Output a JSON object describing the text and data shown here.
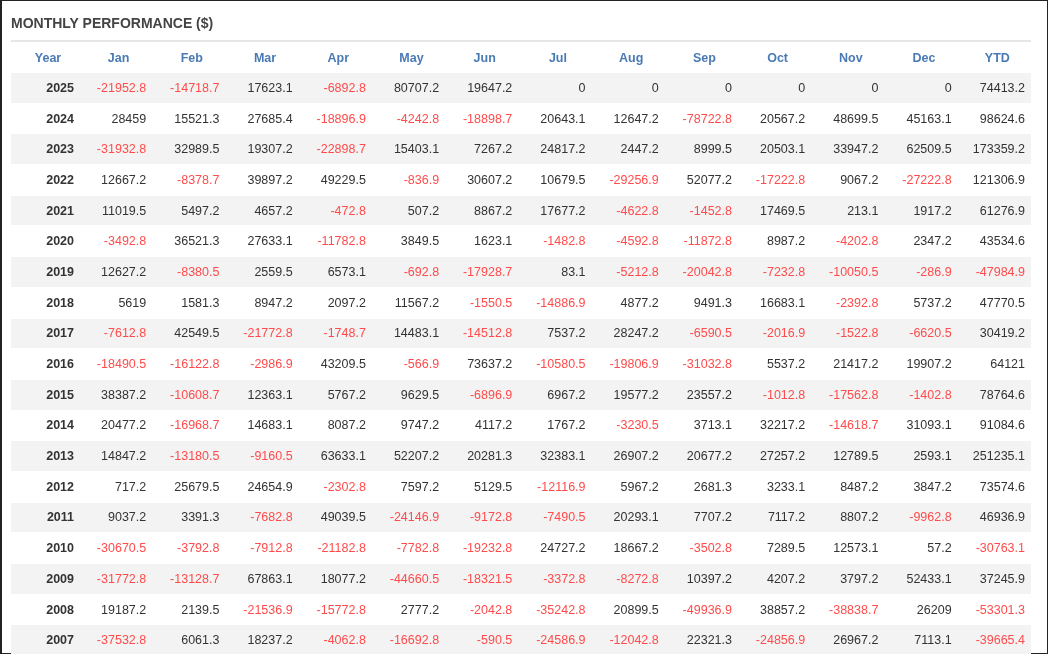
{
  "title": "MONTHLY PERFORMANCE ($)",
  "columns": [
    "Year",
    "Jan",
    "Feb",
    "Mar",
    "Apr",
    "May",
    "Jun",
    "Jul",
    "Aug",
    "Sep",
    "Oct",
    "Nov",
    "Dec",
    "YTD"
  ],
  "rows": [
    {
      "year": "2025",
      "values": [
        "-21952.8",
        "-14718.7",
        "17623.1",
        "-6892.8",
        "80707.2",
        "19647.2",
        "0",
        "0",
        "0",
        "0",
        "0",
        "0",
        "74413.2"
      ],
      "loss": [
        true,
        true,
        false,
        true,
        false,
        false,
        false,
        false,
        false,
        false,
        false,
        false,
        false
      ]
    },
    {
      "year": "2024",
      "values": [
        "28459",
        "15521.3",
        "27685.4",
        "-18896.9",
        "-4242.8",
        "-18898.7",
        "20643.1",
        "12647.2",
        "-78722.8",
        "20567.2",
        "48699.5",
        "45163.1",
        "98624.6"
      ],
      "loss": [
        false,
        false,
        false,
        true,
        true,
        true,
        false,
        false,
        true,
        false,
        false,
        false,
        false
      ]
    },
    {
      "year": "2023",
      "values": [
        "-31932.8",
        "32989.5",
        "19307.2",
        "-22898.7",
        "15403.1",
        "7267.2",
        "24817.2",
        "2447.2",
        "8999.5",
        "20503.1",
        "33947.2",
        "62509.5",
        "173359.2"
      ],
      "loss": [
        true,
        false,
        false,
        true,
        false,
        false,
        false,
        false,
        false,
        false,
        false,
        false,
        false
      ]
    },
    {
      "year": "2022",
      "values": [
        "12667.2",
        "-8378.7",
        "39897.2",
        "49229.5",
        "-836.9",
        "30607.2",
        "10679.5",
        "-29256.9",
        "52077.2",
        "-17222.8",
        "9067.2",
        "-27222.8",
        "121306.9"
      ],
      "loss": [
        false,
        true,
        false,
        false,
        true,
        false,
        false,
        true,
        false,
        true,
        false,
        true,
        false
      ]
    },
    {
      "year": "2021",
      "values": [
        "11019.5",
        "5497.2",
        "4657.2",
        "-472.8",
        "507.2",
        "8867.2",
        "17677.2",
        "-4622.8",
        "-1452.8",
        "17469.5",
        "213.1",
        "1917.2",
        "61276.9"
      ],
      "loss": [
        false,
        false,
        false,
        true,
        false,
        false,
        false,
        true,
        true,
        false,
        false,
        false,
        false
      ]
    },
    {
      "year": "2020",
      "values": [
        "-3492.8",
        "36521.3",
        "27633.1",
        "-11782.8",
        "3849.5",
        "1623.1",
        "-1482.8",
        "-4592.8",
        "-11872.8",
        "8987.2",
        "-4202.8",
        "2347.2",
        "43534.6"
      ],
      "loss": [
        true,
        false,
        false,
        true,
        false,
        false,
        true,
        true,
        true,
        false,
        true,
        false,
        false
      ]
    },
    {
      "year": "2019",
      "values": [
        "12627.2",
        "-8380.5",
        "2559.5",
        "6573.1",
        "-692.8",
        "-17928.7",
        "83.1",
        "-5212.8",
        "-20042.8",
        "-7232.8",
        "-10050.5",
        "-286.9",
        "-47984.9"
      ],
      "loss": [
        false,
        true,
        false,
        false,
        true,
        true,
        false,
        true,
        true,
        true,
        true,
        true,
        true
      ]
    },
    {
      "year": "2018",
      "values": [
        "5619",
        "1581.3",
        "8947.2",
        "2097.2",
        "11567.2",
        "-1550.5",
        "-14886.9",
        "4877.2",
        "9491.3",
        "16683.1",
        "-2392.8",
        "5737.2",
        "47770.5"
      ],
      "loss": [
        false,
        false,
        false,
        false,
        false,
        true,
        true,
        false,
        false,
        false,
        true,
        false,
        false
      ]
    },
    {
      "year": "2017",
      "values": [
        "-7612.8",
        "42549.5",
        "-21772.8",
        "-1748.7",
        "14483.1",
        "-14512.8",
        "7537.2",
        "28247.2",
        "-6590.5",
        "-2016.9",
        "-1522.8",
        "-6620.5",
        "30419.2"
      ],
      "loss": [
        true,
        false,
        true,
        true,
        false,
        true,
        false,
        false,
        true,
        true,
        true,
        true,
        false
      ]
    },
    {
      "year": "2016",
      "values": [
        "-18490.5",
        "-16122.8",
        "-2986.9",
        "43209.5",
        "-566.9",
        "73637.2",
        "-10580.5",
        "-19806.9",
        "-31032.8",
        "5537.2",
        "21417.2",
        "19907.2",
        "64121"
      ],
      "loss": [
        true,
        true,
        true,
        false,
        true,
        false,
        true,
        true,
        true,
        false,
        false,
        false,
        false
      ]
    },
    {
      "year": "2015",
      "values": [
        "38387.2",
        "-10608.7",
        "12363.1",
        "5767.2",
        "9629.5",
        "-6896.9",
        "6967.2",
        "19577.2",
        "23557.2",
        "-1012.8",
        "-17562.8",
        "-1402.8",
        "78764.6"
      ],
      "loss": [
        false,
        true,
        false,
        false,
        false,
        true,
        false,
        false,
        false,
        true,
        true,
        true,
        false
      ]
    },
    {
      "year": "2014",
      "values": [
        "20477.2",
        "-16968.7",
        "14683.1",
        "8087.2",
        "9747.2",
        "4117.2",
        "1767.2",
        "-3230.5",
        "3713.1",
        "32217.2",
        "-14618.7",
        "31093.1",
        "91084.6"
      ],
      "loss": [
        false,
        true,
        false,
        false,
        false,
        false,
        false,
        true,
        false,
        false,
        true,
        false,
        false
      ]
    },
    {
      "year": "2013",
      "values": [
        "14847.2",
        "-13180.5",
        "-9160.5",
        "63633.1",
        "52207.2",
        "20281.3",
        "32383.1",
        "26907.2",
        "20677.2",
        "27257.2",
        "12789.5",
        "2593.1",
        "251235.1"
      ],
      "loss": [
        false,
        true,
        true,
        false,
        false,
        false,
        false,
        false,
        false,
        false,
        false,
        false,
        false
      ]
    },
    {
      "year": "2012",
      "values": [
        "717.2",
        "25679.5",
        "24654.9",
        "-2302.8",
        "7597.2",
        "5129.5",
        "-12116.9",
        "5967.2",
        "2681.3",
        "3233.1",
        "8487.2",
        "3847.2",
        "73574.6"
      ],
      "loss": [
        false,
        false,
        false,
        true,
        false,
        false,
        true,
        false,
        false,
        false,
        false,
        false,
        false
      ]
    },
    {
      "year": "2011",
      "values": [
        "9037.2",
        "3391.3",
        "-7682.8",
        "49039.5",
        "-24146.9",
        "-9172.8",
        "-7490.5",
        "20293.1",
        "7707.2",
        "7117.2",
        "8807.2",
        "-9962.8",
        "46936.9"
      ],
      "loss": [
        false,
        false,
        true,
        false,
        true,
        true,
        true,
        false,
        false,
        false,
        false,
        true,
        false
      ]
    },
    {
      "year": "2010",
      "values": [
        "-30670.5",
        "-3792.8",
        "-7912.8",
        "-21182.8",
        "-7782.8",
        "-19232.8",
        "24727.2",
        "18667.2",
        "-3502.8",
        "7289.5",
        "12573.1",
        "57.2",
        "-30763.1"
      ],
      "loss": [
        true,
        true,
        true,
        true,
        true,
        true,
        false,
        false,
        true,
        false,
        false,
        false,
        true
      ]
    },
    {
      "year": "2009",
      "values": [
        "-31772.8",
        "-13128.7",
        "67863.1",
        "18077.2",
        "-44660.5",
        "-18321.5",
        "-3372.8",
        "-8272.8",
        "10397.2",
        "4207.2",
        "3797.2",
        "52433.1",
        "37245.9"
      ],
      "loss": [
        true,
        true,
        false,
        false,
        true,
        true,
        true,
        true,
        false,
        false,
        false,
        false,
        false
      ]
    },
    {
      "year": "2008",
      "values": [
        "19187.2",
        "2139.5",
        "-21536.9",
        "-15772.8",
        "2777.2",
        "-2042.8",
        "-35242.8",
        "20899.5",
        "-49936.9",
        "38857.2",
        "-38838.7",
        "26209",
        "-53301.3"
      ],
      "loss": [
        false,
        false,
        true,
        true,
        false,
        true,
        true,
        false,
        true,
        false,
        true,
        false,
        true
      ]
    },
    {
      "year": "2007",
      "values": [
        "-37532.8",
        "6061.3",
        "18237.2",
        "-4062.8",
        "-16692.8",
        "-590.5",
        "-24586.9",
        "-12042.8",
        "22321.3",
        "-24856.9",
        "26967.2",
        "7113.1",
        "-39665.4"
      ],
      "loss": [
        true,
        false,
        false,
        true,
        true,
        true,
        true,
        true,
        false,
        true,
        false,
        false,
        true
      ]
    }
  ]
}
